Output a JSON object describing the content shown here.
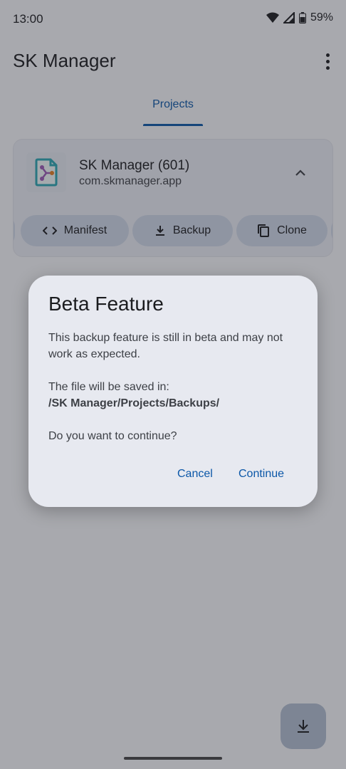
{
  "status_bar": {
    "time": "13:00",
    "battery": "59%"
  },
  "app_bar": {
    "title": "SK Manager"
  },
  "tabs": [
    {
      "label": "Projects"
    }
  ],
  "project_card": {
    "name": "SK Manager (601)",
    "package": "com.skmanager.app",
    "actions": [
      {
        "label": "Manifest",
        "icon": "code-icon"
      },
      {
        "label": "Backup",
        "icon": "download-icon"
      },
      {
        "label": "Clone",
        "icon": "copy-icon"
      }
    ]
  },
  "dialog": {
    "title": "Beta Feature",
    "message": "This backup feature is still in beta and may not work as expected.",
    "saved_label": "The file will be saved in:",
    "path": "/SK Manager/Projects/Backups/",
    "question": "Do you want to continue?",
    "cancel_label": "Cancel",
    "continue_label": "Continue"
  },
  "colors": {
    "accent": "#0b57a8",
    "scrim": "#9f9fa5",
    "dialog_bg": "#e7e9f0"
  }
}
